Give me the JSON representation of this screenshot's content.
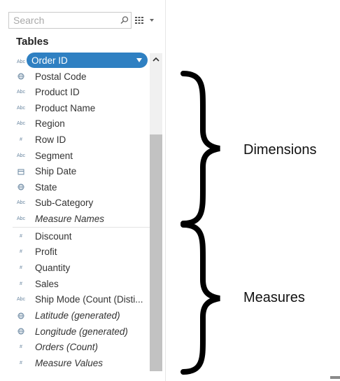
{
  "search": {
    "placeholder": "Search"
  },
  "tables_heading": "Tables",
  "selected_field": {
    "type": "Abc",
    "label": "Order ID"
  },
  "dimensions": [
    {
      "type": "geo",
      "label": "Postal Code",
      "italic": false
    },
    {
      "type": "Abc",
      "label": "Product ID",
      "italic": false
    },
    {
      "type": "Abc",
      "label": "Product Name",
      "italic": false
    },
    {
      "type": "Abc",
      "label": "Region",
      "italic": false
    },
    {
      "type": "#",
      "label": "Row ID",
      "italic": false
    },
    {
      "type": "Abc",
      "label": "Segment",
      "italic": false
    },
    {
      "type": "date",
      "label": "Ship Date",
      "italic": false
    },
    {
      "type": "geo",
      "label": "State",
      "italic": false
    },
    {
      "type": "Abc",
      "label": "Sub-Category",
      "italic": false
    },
    {
      "type": "Abc",
      "label": "Measure Names",
      "italic": true
    }
  ],
  "measures": [
    {
      "type": "#",
      "label": "Discount",
      "italic": false
    },
    {
      "type": "#",
      "label": "Profit",
      "italic": false
    },
    {
      "type": "#",
      "label": "Quantity",
      "italic": false
    },
    {
      "type": "#",
      "label": "Sales",
      "italic": false
    },
    {
      "type": "Abc",
      "label": "Ship Mode (Count (Disti...",
      "italic": false
    },
    {
      "type": "geo",
      "label": "Latitude (generated)",
      "italic": true
    },
    {
      "type": "geo",
      "label": "Longitude (generated)",
      "italic": true
    },
    {
      "type": "#",
      "label": "Orders (Count)",
      "italic": true
    },
    {
      "type": "#",
      "label": "Measure Values",
      "italic": true
    }
  ],
  "annotations": {
    "dimensions": "Dimensions",
    "measures": "Measures"
  },
  "colors": {
    "selected": "#2f80c2",
    "icon": "#6a87a1",
    "brace": "#000000"
  }
}
